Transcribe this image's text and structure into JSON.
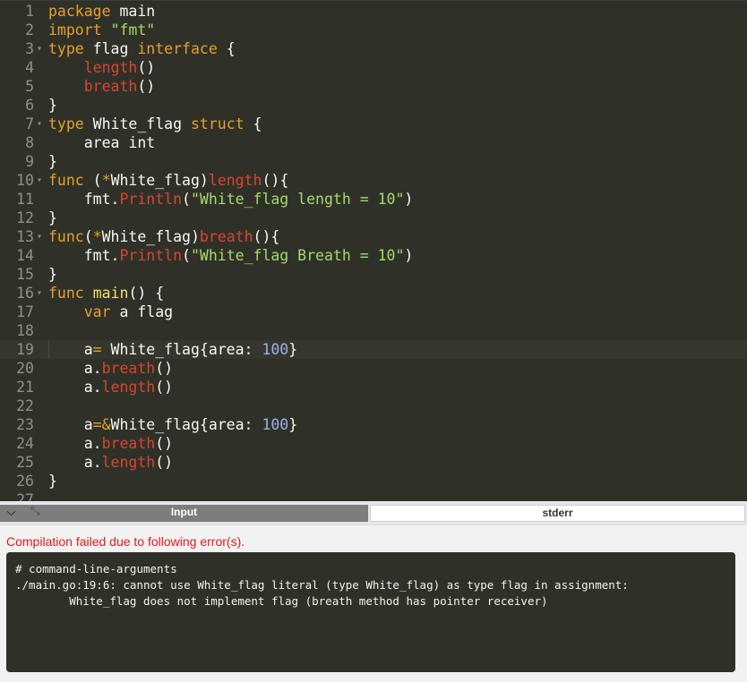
{
  "editor": {
    "active_line": 19,
    "lines": [
      {
        "n": "1",
        "fold": "",
        "tokens": [
          [
            "kw",
            "package"
          ],
          [
            "plain",
            " main"
          ]
        ]
      },
      {
        "n": "2",
        "fold": "",
        "tokens": [
          [
            "kw",
            "import"
          ],
          [
            "plain",
            " "
          ],
          [
            "str",
            "\"fmt\""
          ]
        ]
      },
      {
        "n": "3",
        "fold": "▾",
        "tokens": [
          [
            "kw",
            "type"
          ],
          [
            "plain",
            " flag "
          ],
          [
            "kw",
            "interface"
          ],
          [
            "plain",
            " {"
          ]
        ]
      },
      {
        "n": "4",
        "fold": "",
        "tokens": [
          [
            "plain",
            "    "
          ],
          [
            "red",
            "length"
          ],
          [
            "plain",
            "()"
          ]
        ]
      },
      {
        "n": "5",
        "fold": "",
        "tokens": [
          [
            "plain",
            "    "
          ],
          [
            "red",
            "breath"
          ],
          [
            "plain",
            "()"
          ]
        ]
      },
      {
        "n": "6",
        "fold": "",
        "tokens": [
          [
            "plain",
            "}"
          ]
        ]
      },
      {
        "n": "7",
        "fold": "▾",
        "tokens": [
          [
            "kw",
            "type"
          ],
          [
            "plain",
            " White_flag "
          ],
          [
            "kw",
            "struct"
          ],
          [
            "plain",
            " {"
          ]
        ]
      },
      {
        "n": "8",
        "fold": "",
        "tokens": [
          [
            "plain",
            "    area int"
          ]
        ]
      },
      {
        "n": "9",
        "fold": "",
        "tokens": [
          [
            "plain",
            "}"
          ]
        ]
      },
      {
        "n": "10",
        "fold": "▾",
        "tokens": [
          [
            "kw",
            "func"
          ],
          [
            "plain",
            " ("
          ],
          [
            "op",
            "*"
          ],
          [
            "plain",
            "White_flag)"
          ],
          [
            "red",
            "length"
          ],
          [
            "plain",
            "(){"
          ]
        ]
      },
      {
        "n": "11",
        "fold": "",
        "tokens": [
          [
            "plain",
            "    fmt."
          ],
          [
            "red",
            "Println"
          ],
          [
            "plain",
            "("
          ],
          [
            "str",
            "\"White_flag length = 10\""
          ],
          [
            "plain",
            ")"
          ]
        ]
      },
      {
        "n": "12",
        "fold": "",
        "tokens": [
          [
            "plain",
            "}"
          ]
        ]
      },
      {
        "n": "13",
        "fold": "▾",
        "tokens": [
          [
            "kw",
            "func"
          ],
          [
            "plain",
            "("
          ],
          [
            "op",
            "*"
          ],
          [
            "plain",
            "White_flag)"
          ],
          [
            "red",
            "breath"
          ],
          [
            "plain",
            "(){"
          ]
        ]
      },
      {
        "n": "14",
        "fold": "",
        "tokens": [
          [
            "plain",
            "    fmt."
          ],
          [
            "red",
            "Println"
          ],
          [
            "plain",
            "("
          ],
          [
            "str",
            "\"White_flag Breath = 10\""
          ],
          [
            "plain",
            ")"
          ]
        ]
      },
      {
        "n": "15",
        "fold": "",
        "tokens": [
          [
            "plain",
            "}"
          ]
        ]
      },
      {
        "n": "16",
        "fold": "▾",
        "tokens": [
          [
            "kw",
            "func"
          ],
          [
            "plain",
            " "
          ],
          [
            "fn",
            "main"
          ],
          [
            "plain",
            "() {"
          ]
        ]
      },
      {
        "n": "17",
        "fold": "",
        "tokens": [
          [
            "plain",
            "    "
          ],
          [
            "kw",
            "var"
          ],
          [
            "plain",
            " a flag"
          ]
        ]
      },
      {
        "n": "18",
        "fold": "",
        "tokens": [
          [
            "plain",
            ""
          ]
        ]
      },
      {
        "n": "19",
        "fold": "",
        "tokens": [
          [
            "plain",
            "    a"
          ],
          [
            "op",
            "="
          ],
          [
            "plain",
            " White_flag{area: "
          ],
          [
            "num",
            "100"
          ],
          [
            "plain",
            "}"
          ]
        ]
      },
      {
        "n": "20",
        "fold": "",
        "tokens": [
          [
            "plain",
            "    a."
          ],
          [
            "red",
            "breath"
          ],
          [
            "plain",
            "()"
          ]
        ]
      },
      {
        "n": "21",
        "fold": "",
        "tokens": [
          [
            "plain",
            "    a."
          ],
          [
            "red",
            "length"
          ],
          [
            "plain",
            "()"
          ]
        ]
      },
      {
        "n": "22",
        "fold": "",
        "tokens": [
          [
            "plain",
            ""
          ]
        ]
      },
      {
        "n": "23",
        "fold": "",
        "tokens": [
          [
            "plain",
            "    a"
          ],
          [
            "op",
            "=&"
          ],
          [
            "plain",
            "White_flag{area: "
          ],
          [
            "num",
            "100"
          ],
          [
            "plain",
            "}"
          ]
        ]
      },
      {
        "n": "24",
        "fold": "",
        "tokens": [
          [
            "plain",
            "    a."
          ],
          [
            "red",
            "breath"
          ],
          [
            "plain",
            "()"
          ]
        ]
      },
      {
        "n": "25",
        "fold": "",
        "tokens": [
          [
            "plain",
            "    a."
          ],
          [
            "red",
            "length"
          ],
          [
            "plain",
            "()"
          ]
        ]
      },
      {
        "n": "26",
        "fold": "",
        "tokens": [
          [
            "plain",
            "}"
          ]
        ]
      },
      {
        "n": "27",
        "fold": "",
        "tokens": [
          [
            "plain",
            ""
          ]
        ]
      }
    ]
  },
  "panel": {
    "collapse_icon": "chevron-down-icon",
    "expand_icon": "expand-arrows-icon",
    "tabs": {
      "input": "Input",
      "stderr": "stderr"
    },
    "error_title": "Compilation failed due to following error(s).",
    "output_lines": [
      "# command-line-arguments",
      "./main.go:19:6: cannot use White_flag literal (type White_flag) as type flag in assignment:",
      "        White_flag does not implement flag (breath method has pointer receiver)"
    ]
  }
}
